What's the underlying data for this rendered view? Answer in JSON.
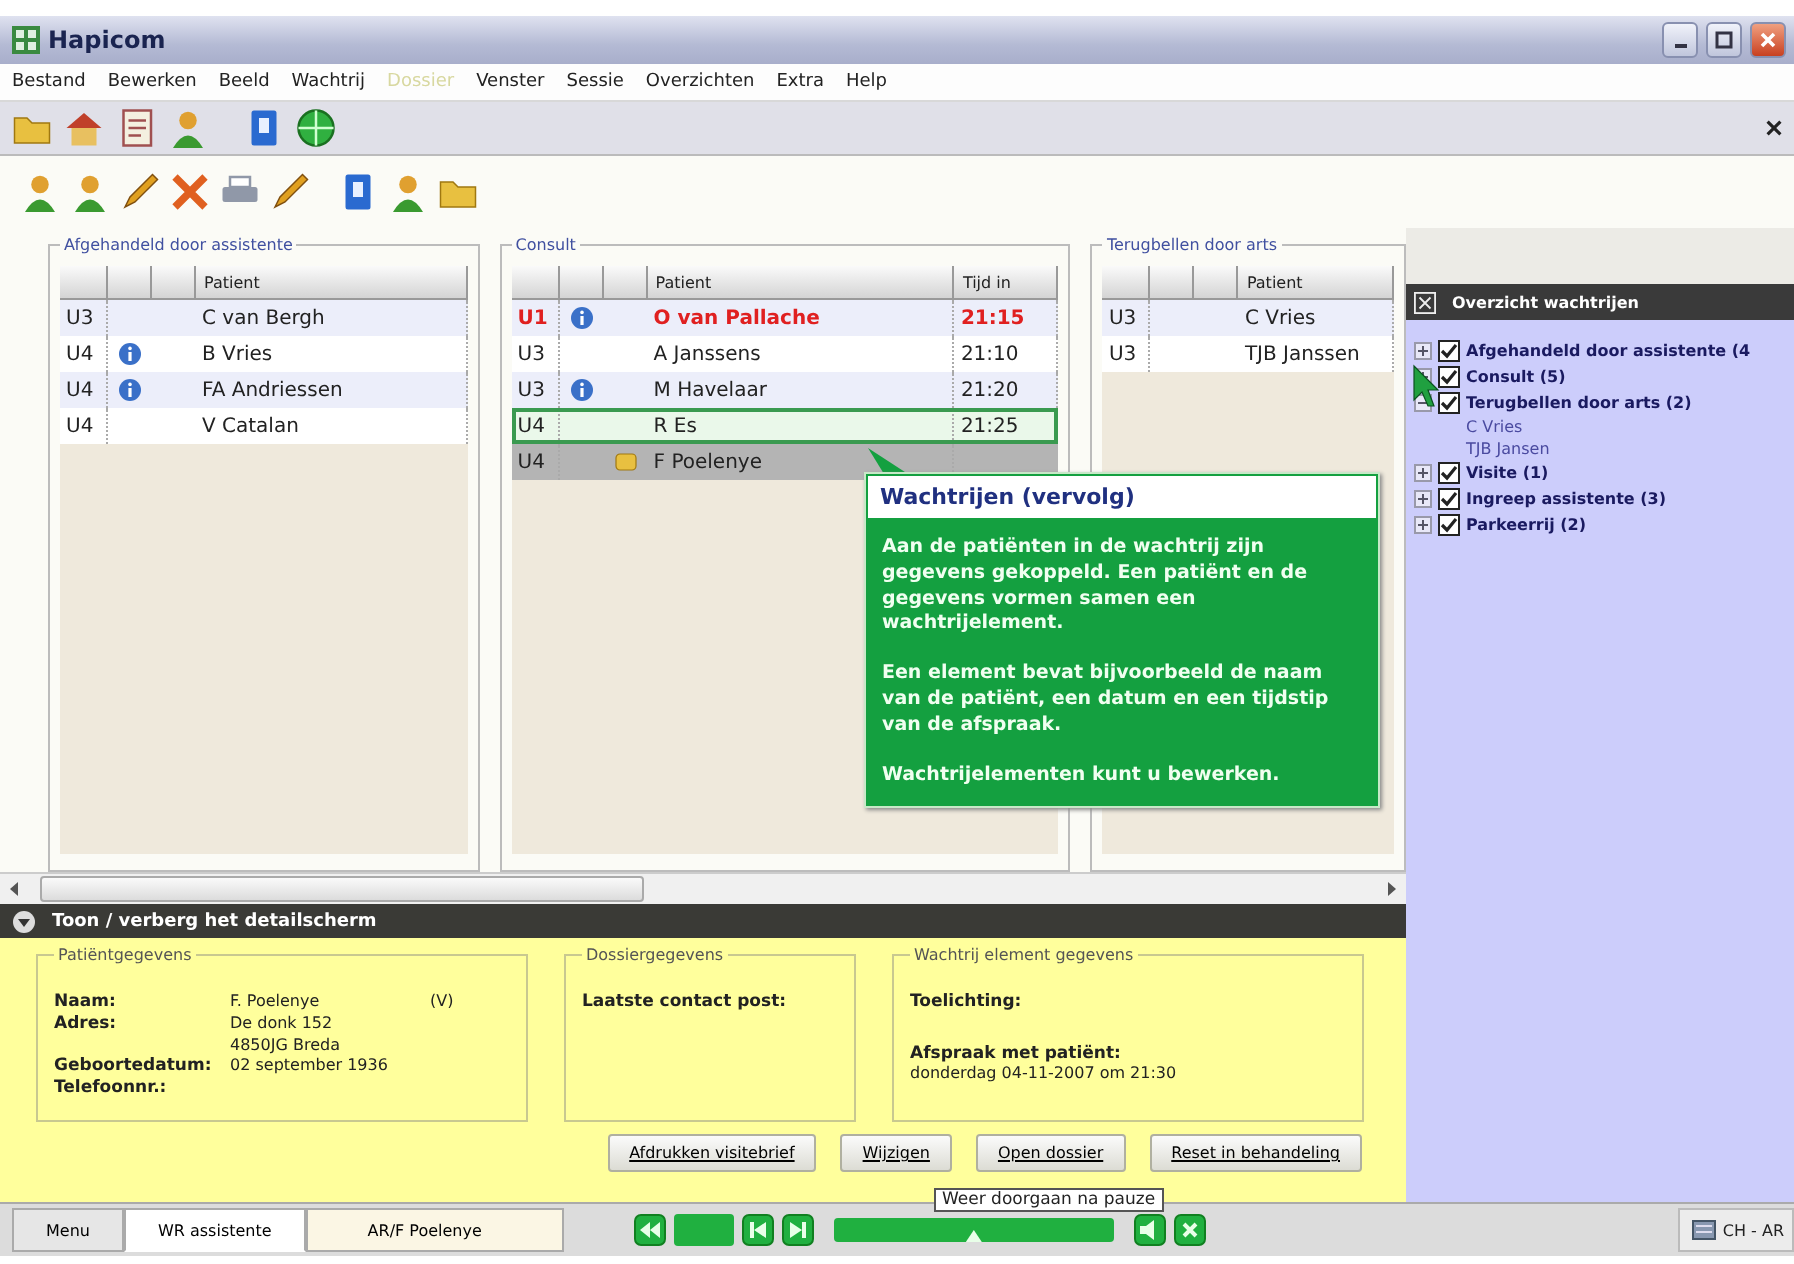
{
  "window": {
    "title": "Hapicom"
  },
  "menu": [
    {
      "label": "Bestand",
      "disabled": false
    },
    {
      "label": "Bewerken",
      "disabled": false
    },
    {
      "label": "Beeld",
      "disabled": false
    },
    {
      "label": "Wachtrij",
      "disabled": false
    },
    {
      "label": "Dossier",
      "disabled": true
    },
    {
      "label": "Venster",
      "disabled": false
    },
    {
      "label": "Sessie",
      "disabled": false
    },
    {
      "label": "Overzichten",
      "disabled": false
    },
    {
      "label": "Extra",
      "disabled": false
    },
    {
      "label": "Help",
      "disabled": false
    }
  ],
  "queues": [
    {
      "title": "Afgehandeld door assistente",
      "columns": [
        "Patient"
      ],
      "rows": [
        {
          "urgency": "U3",
          "info": false,
          "note": false,
          "urgent": false,
          "selected": false,
          "highlighted": false,
          "patient": "C van Bergh"
        },
        {
          "urgency": "U4",
          "info": true,
          "note": false,
          "urgent": false,
          "selected": false,
          "highlighted": false,
          "patient": "B Vries"
        },
        {
          "urgency": "U4",
          "info": true,
          "note": false,
          "urgent": false,
          "selected": false,
          "highlighted": false,
          "patient": "FA Andriessen"
        },
        {
          "urgency": "U4",
          "info": false,
          "note": false,
          "urgent": false,
          "selected": false,
          "highlighted": false,
          "patient": "V Catalan"
        }
      ]
    },
    {
      "title": "Consult",
      "columns": [
        "Patient",
        "Tijd in"
      ],
      "rows": [
        {
          "urgency": "U1",
          "info": true,
          "note": false,
          "urgent": true,
          "selected": false,
          "highlighted": false,
          "patient": "O van Pallache",
          "time": "21:15"
        },
        {
          "urgency": "U3",
          "info": false,
          "note": false,
          "urgent": false,
          "selected": false,
          "highlighted": false,
          "patient": "A Janssens",
          "time": "21:10"
        },
        {
          "urgency": "U3",
          "info": true,
          "note": false,
          "urgent": false,
          "selected": false,
          "highlighted": false,
          "patient": "M Havelaar",
          "time": "21:20"
        },
        {
          "urgency": "U4",
          "info": false,
          "note": false,
          "urgent": false,
          "selected": true,
          "highlighted": false,
          "patient": "R Es",
          "time": "21:25"
        },
        {
          "urgency": "U4",
          "info": false,
          "note": true,
          "urgent": false,
          "selected": false,
          "highlighted": true,
          "patient": "F Poelenye"
        }
      ]
    },
    {
      "title": "Terugbellen door arts",
      "columns": [
        "Patient"
      ],
      "rows": [
        {
          "urgency": "U3",
          "info": false,
          "note": false,
          "urgent": false,
          "selected": false,
          "highlighted": false,
          "patient": "C Vries"
        },
        {
          "urgency": "U3",
          "info": false,
          "note": false,
          "urgent": false,
          "selected": false,
          "highlighted": false,
          "patient": "TJB Janssen"
        }
      ]
    }
  ],
  "callout": {
    "title": "Wachtrijen (vervolg)",
    "paragraphs": [
      "Aan de patiënten in de wachtrij zijn gegevens gekoppeld. Een patiënt en de gegevens vormen samen een **wachtrijelement**.",
      "Een element bevat bijvoorbeeld de **naam** van de patiënt, een **datum** en een **tijdstip** van de afspraak.",
      "Wachtrijelementen kunt u bewerken."
    ]
  },
  "overview": {
    "title": "Overzicht wachtrijen",
    "items": [
      {
        "label": "Afgehandeld door assistente (4",
        "checked": true,
        "expanded": false
      },
      {
        "label": "Consult (5)",
        "checked": true,
        "expanded": false
      },
      {
        "label": "Terugbellen door arts (2)",
        "checked": true,
        "expanded": true,
        "children": [
          {
            "label": "C Vries"
          },
          {
            "label": "TJB Jansen"
          }
        ]
      },
      {
        "label": "Visite (1)",
        "checked": true,
        "expanded": false
      },
      {
        "label": "Ingreep assistente (3)",
        "checked": true,
        "expanded": false
      },
      {
        "label": "Parkeerrij (2)",
        "checked": true,
        "expanded": false
      }
    ]
  },
  "detail": {
    "header": "Toon / verberg het detailscherm",
    "patient": {
      "title": "Patiëntgegevens",
      "fields": [
        {
          "label": "Naam:",
          "value": "F. Poelenye",
          "extra": "(V)"
        },
        {
          "label": "Adres:",
          "value": "De donk 152"
        },
        {
          "value": "4850JG Breda"
        },
        {
          "label": "Geboortedatum:",
          "value": "02 september 1936"
        },
        {
          "label": "Telefoonnr.:"
        }
      ]
    },
    "dossier": {
      "title": "Dossiergegevens",
      "label": "Laatste contact post:"
    },
    "queue_element": {
      "title": "Wachtrij element gegevens",
      "note_label": "Toelichting:",
      "appointment_label": "Afspraak met patiënt:",
      "appointment": "donderdag 04-11-2007 om 21:30"
    },
    "buttons": [
      "Afdrukken visitebrief",
      "Wijzigen",
      "Open dossier",
      "Reset in behandeling"
    ]
  },
  "taskbar": {
    "tabs": [
      {
        "label": "Menu",
        "kind": "menu",
        "selected": false
      },
      {
        "label": "WR assistente",
        "kind": "queue",
        "selected": true
      },
      {
        "label": "AR/F Poelenye",
        "kind": "record",
        "selected": false
      }
    ],
    "player": {
      "level": 0.5,
      "tooltip": "Weer doorgaan na pauze"
    },
    "tray": "CH - AR"
  }
}
